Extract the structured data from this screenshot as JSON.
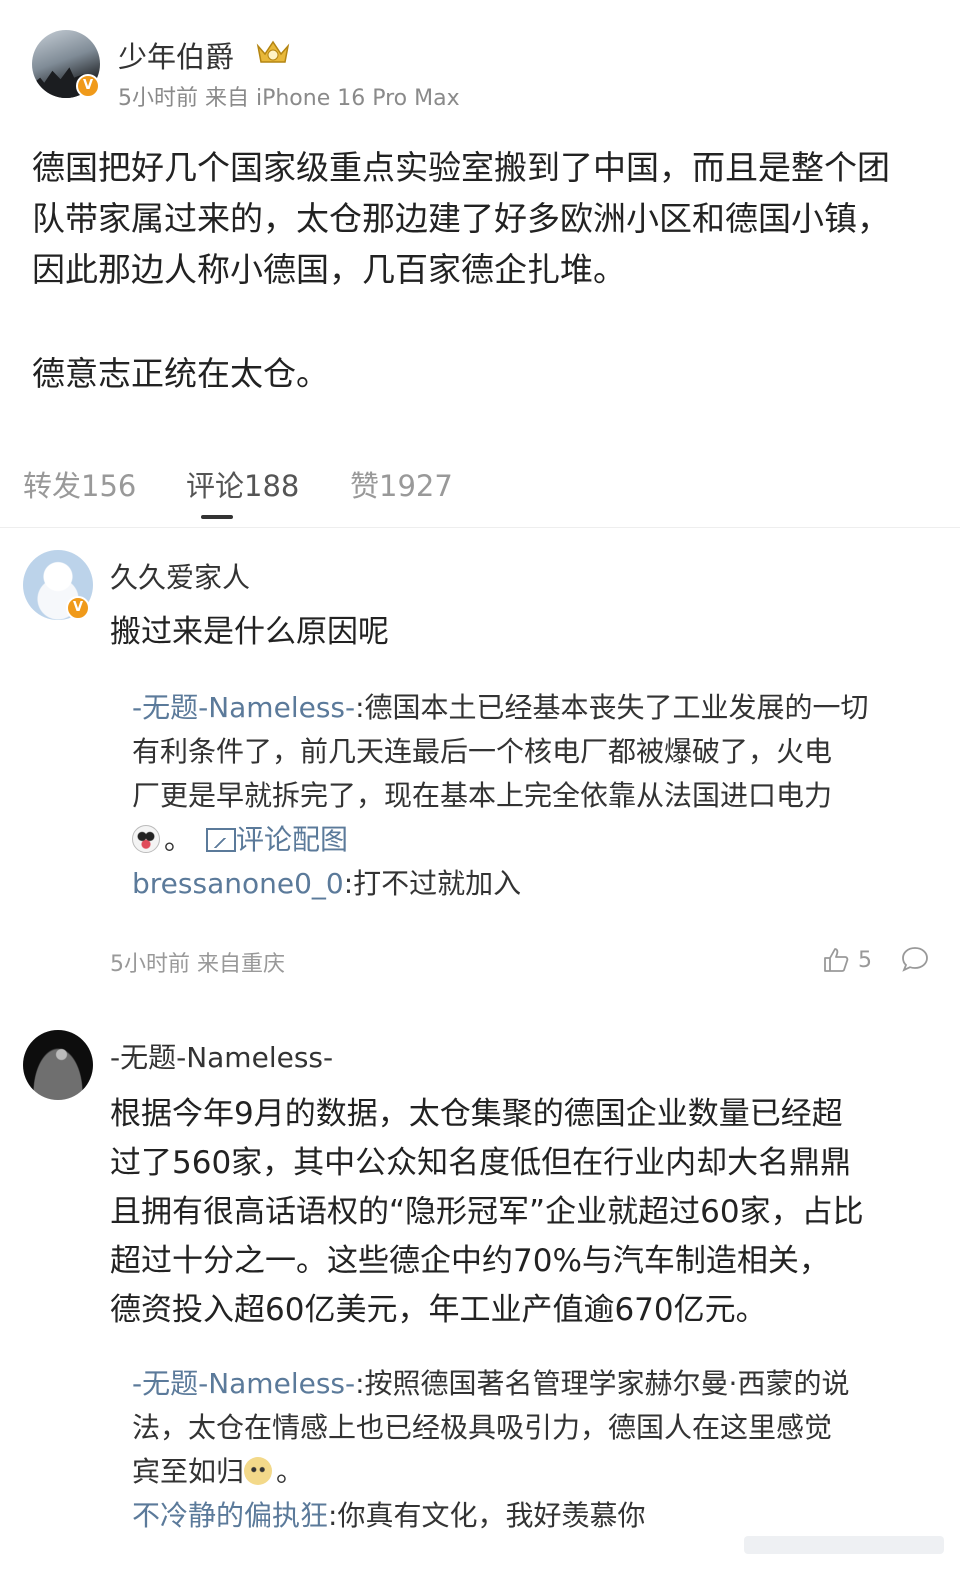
{
  "post": {
    "author": "少年伯爵",
    "meta": "5小时前 来自 iPhone 16 Pro Max",
    "body_lines": [
      "德国把好几个国家级重点实验室搬到了中国，而且是整个团",
      "队带家属过来的，太仓那边建了好多欧洲小区和德国小镇，",
      "因此那边人称小德国，几百家德企扎堆。",
      "德意志正统在太仓。"
    ],
    "verified_badge": "V"
  },
  "tabs": [
    {
      "label": "转发156"
    },
    {
      "label": "评论188"
    },
    {
      "label": "赞1927"
    }
  ],
  "comments": [
    {
      "author": "久久爱家人",
      "text": "搬过来是什么原因呢",
      "replies": [
        {
          "author": "-无题-Nameless-",
          "lines": [
            "德国本土已经基本丧失了工业发展的一切",
            "有利条件了，前几天连最后一个核电厂都被爆破了，火电",
            "厂更是早就拆完了，现在基本上完全依靠从法国进口电力"
          ],
          "tail": "。",
          "pic_label": "评论配图"
        },
        {
          "author": "bressanone0_0",
          "text": "打不过就加入"
        }
      ],
      "meta": "5小时前 来自重庆",
      "likes": "5",
      "icons": {
        "like": "thumbs-up-icon",
        "reply": "comment-bubble-icon"
      }
    },
    {
      "author": "-无题-Nameless-",
      "text_lines": [
        "根据今年9月的数据，太仓集聚的德国企业数量已经超",
        "过了560家，其中公众知名度低但在行业内却大名鼎鼎",
        "且拥有很高话语权的“隐形冠军”企业就超过60家，占比",
        "超过十分之一。这些德企中约70%与汽车制造相关，",
        "德资投入超60亿美元，年工业产值逾670亿元。"
      ],
      "replies": [
        {
          "author": "-无题-Nameless-",
          "lines": [
            "按照德国著名管理学家赫尔曼·西蒙的说",
            "法，太仓在情感上也已经极具吸引力，德国人在这里感觉",
            "宾至如归"
          ],
          "tail": "。"
        },
        {
          "author": "不冷静的偏执狂",
          "text": "你真有文化，我好羡慕你"
        }
      ]
    }
  ]
}
